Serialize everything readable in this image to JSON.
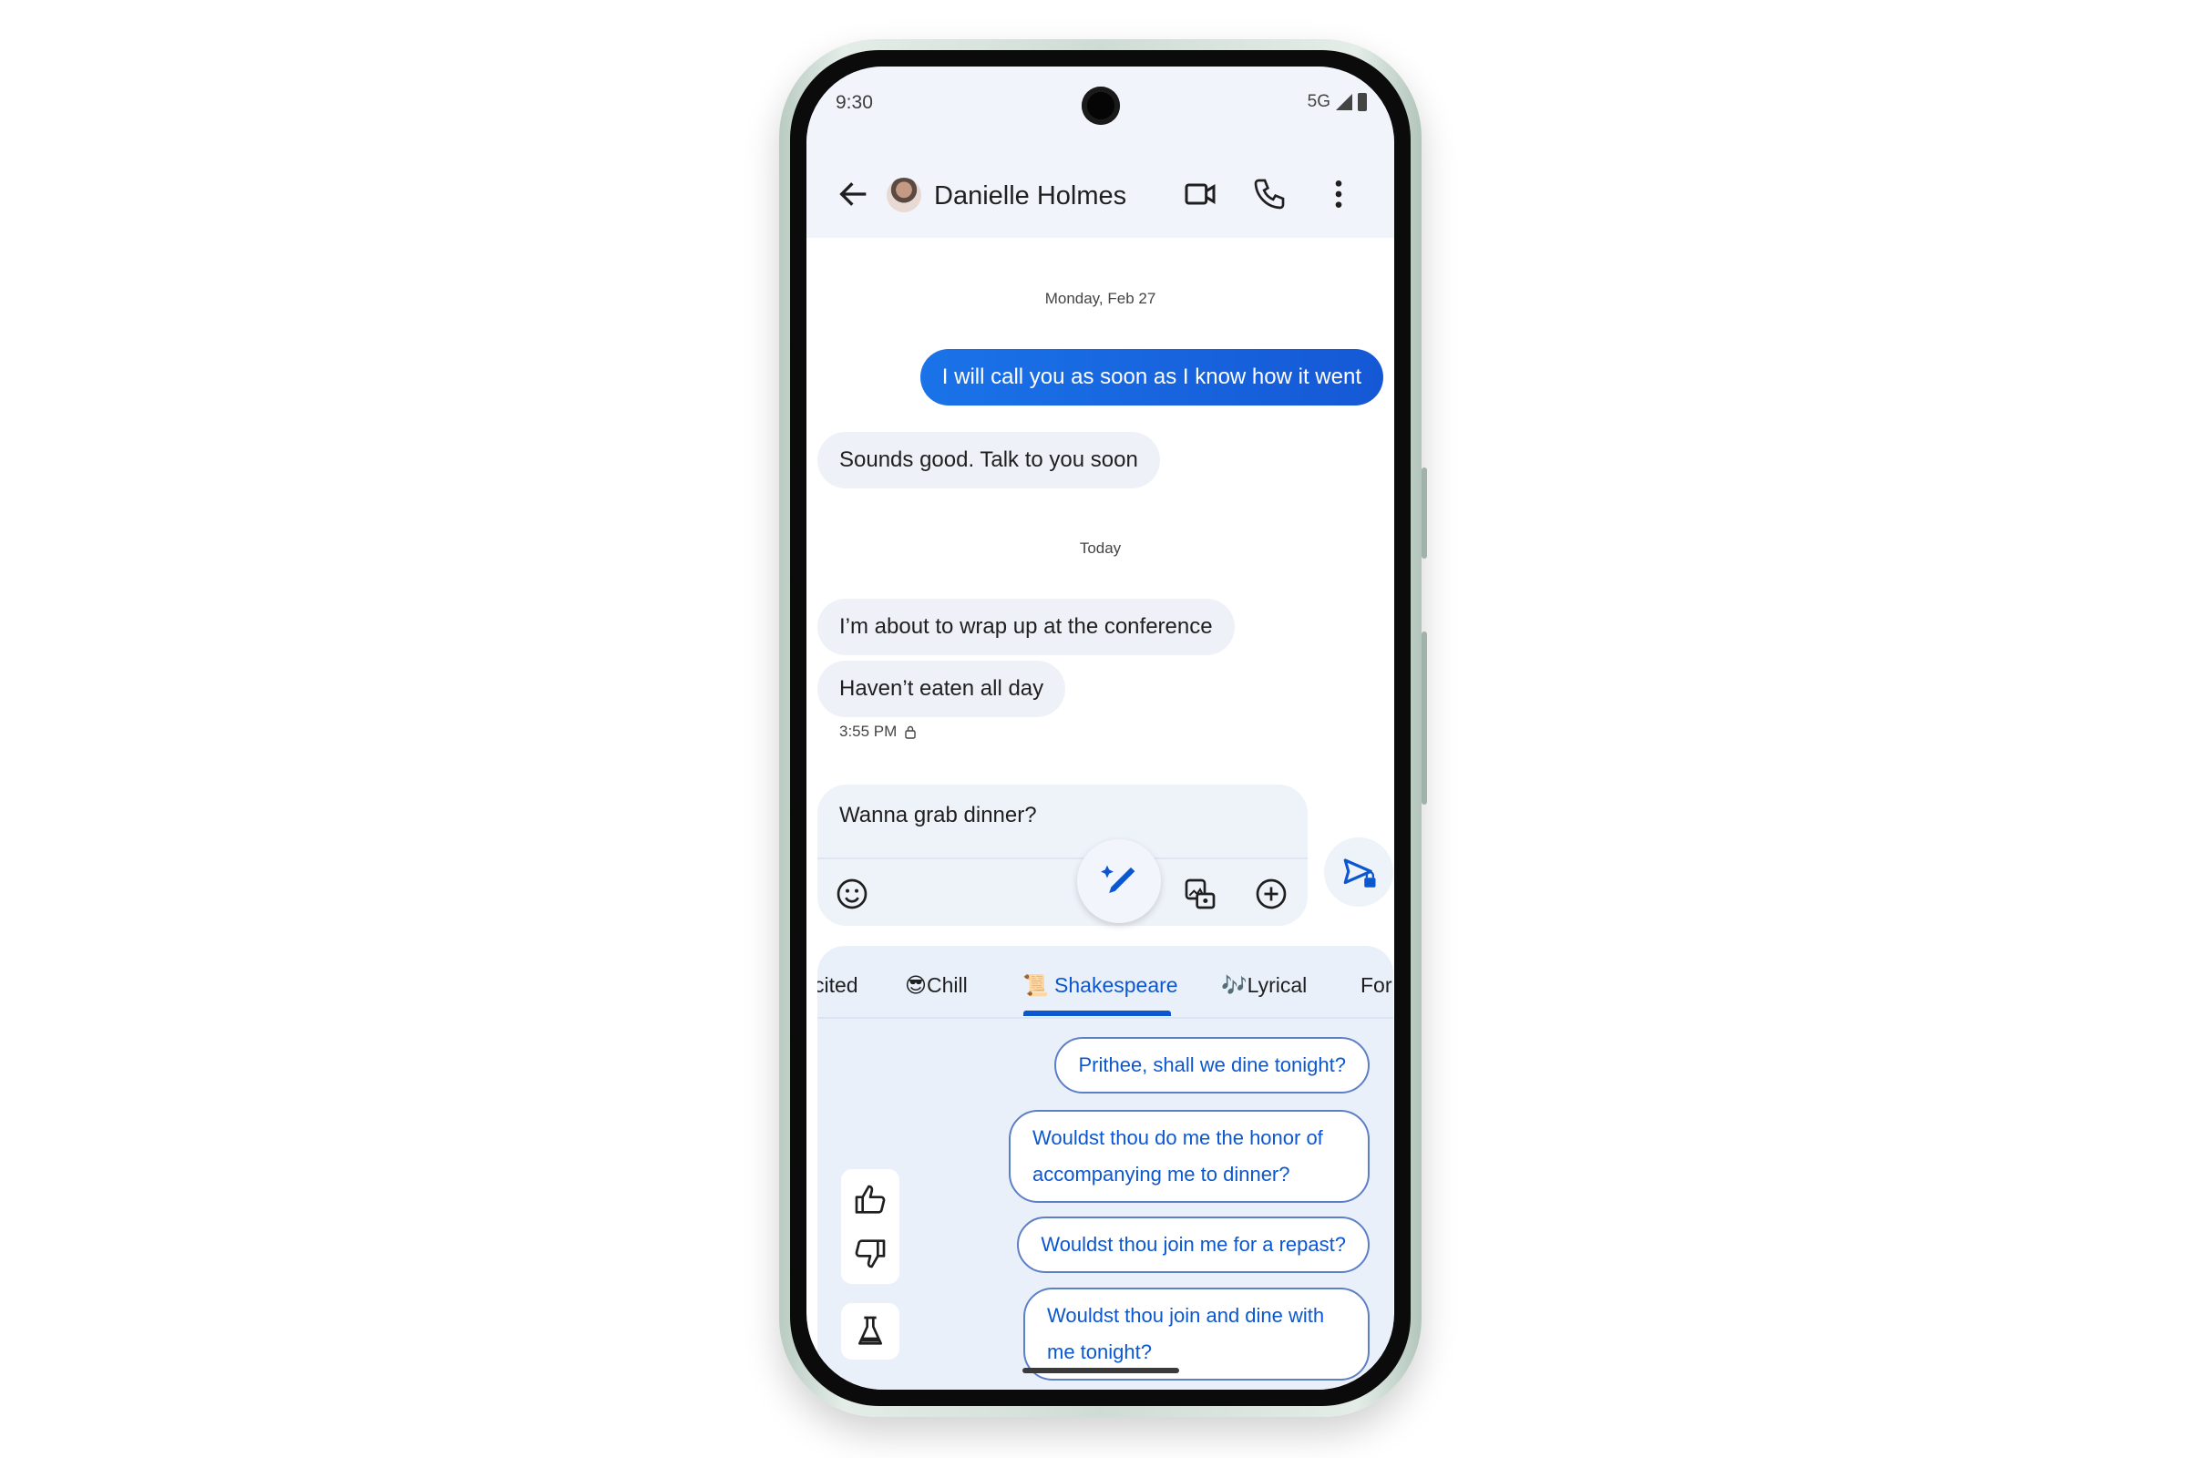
{
  "status_bar": {
    "time": "9:30",
    "network": "5G"
  },
  "header": {
    "contact_name": "Danielle Holmes",
    "icons": [
      "back-arrow-icon",
      "avatar",
      "video-call-icon",
      "phone-icon",
      "more-vert-icon"
    ]
  },
  "conversation": {
    "date_separators": [
      "Monday, Feb 27",
      "Today"
    ],
    "messages": [
      {
        "direction": "outgoing",
        "text": "I will call you as soon as I know how it went"
      },
      {
        "direction": "incoming",
        "text": "Sounds good. Talk to you soon"
      },
      {
        "direction": "incoming",
        "text": "I’m about to wrap up at the conference"
      },
      {
        "direction": "incoming",
        "text": "Haven’t eaten all day"
      }
    ],
    "last_timestamp": "3:55 PM"
  },
  "compose": {
    "text": "Wanna grab dinner?",
    "icons": [
      "emoji-icon",
      "magic-compose-icon",
      "gallery-icon",
      "add-icon",
      "send-encrypted-icon"
    ]
  },
  "magic_compose": {
    "tabs": [
      {
        "label": "cited",
        "emoji": ""
      },
      {
        "label": "Chill",
        "emoji": "😎"
      },
      {
        "label": "Shakespeare",
        "emoji": "📜"
      },
      {
        "label": "Lyrical",
        "emoji": "🎶"
      },
      {
        "label": "For",
        "emoji": ""
      }
    ],
    "active_tab": "Shakespeare",
    "suggestions": [
      "Prithee, shall we dine tonight?",
      "Wouldst thou do me the honor of accompanying me to dinner?",
      "Wouldst thou join me for a repast?",
      "Wouldst thou join and dine with me tonight?"
    ],
    "feedback_icons": [
      "thumbs-up-icon",
      "thumbs-down-icon",
      "labs-flask-icon"
    ]
  },
  "colors": {
    "accent": "#0b57d0",
    "outgoing_bubble": "#1a73e8",
    "incoming_bubble": "#eef1f7",
    "panel_bg": "#eaf0fa"
  }
}
